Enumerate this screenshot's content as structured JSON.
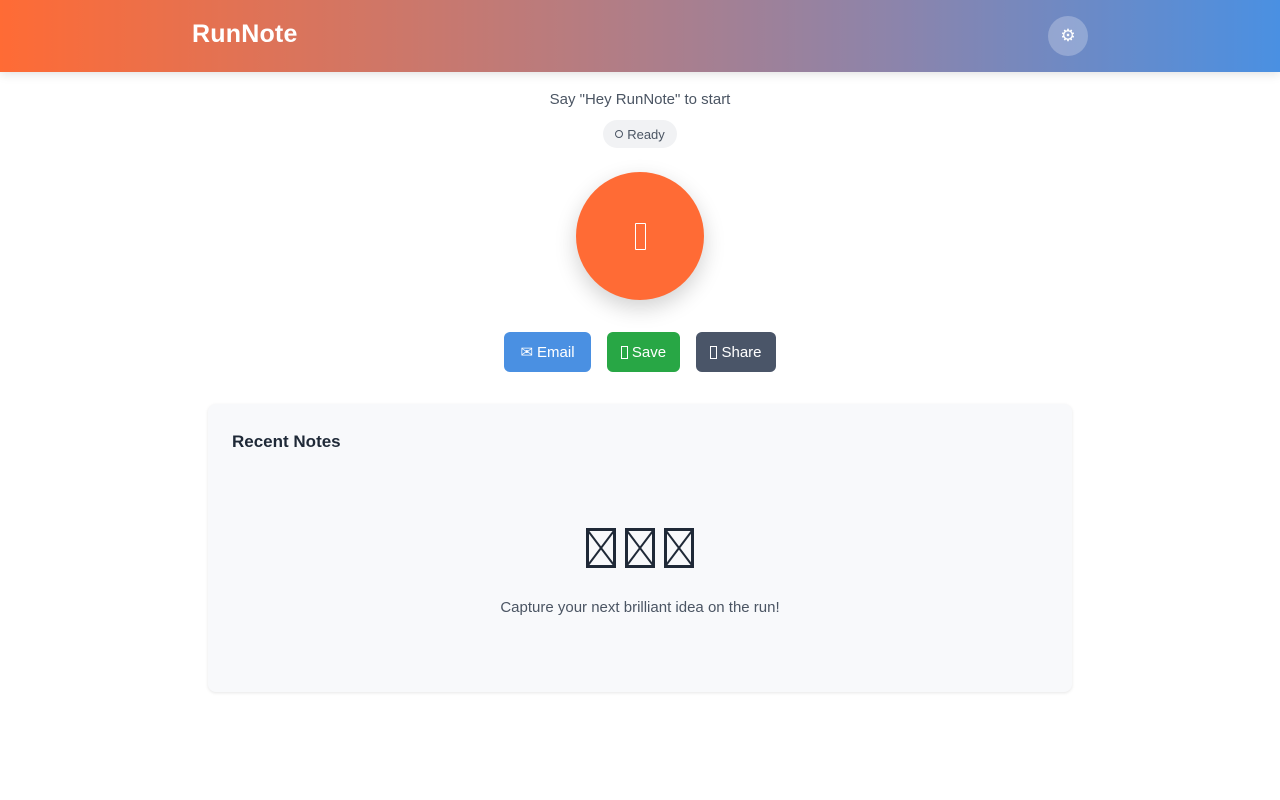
{
  "header": {
    "brand": "RunNote",
    "settings_icon": "gear-icon",
    "settings_glyph": "⚙",
    "gradient_start": "#ff6b35",
    "gradient_end": "#4a90e2"
  },
  "main": {
    "prompt": "Say \"Hey RunNote\" to start",
    "status": {
      "label": "Ready",
      "icon": "status-circle-icon"
    },
    "mic_button": {
      "icon": "microphone-icon",
      "color": "#ff6b35"
    },
    "actions": [
      {
        "label": "Email",
        "glyph": "✉",
        "icon": "envelope-icon",
        "color": "#4a90e2"
      },
      {
        "label": "Save",
        "icon": "save-icon",
        "color": "#28a745"
      },
      {
        "label": "Share",
        "icon": "share-icon",
        "color": "#4a5568"
      }
    ]
  },
  "recent_notes": {
    "title": "Recent Notes",
    "empty_icon": "running-notes-icon",
    "empty_message": "Capture your next brilliant idea on the run!"
  }
}
